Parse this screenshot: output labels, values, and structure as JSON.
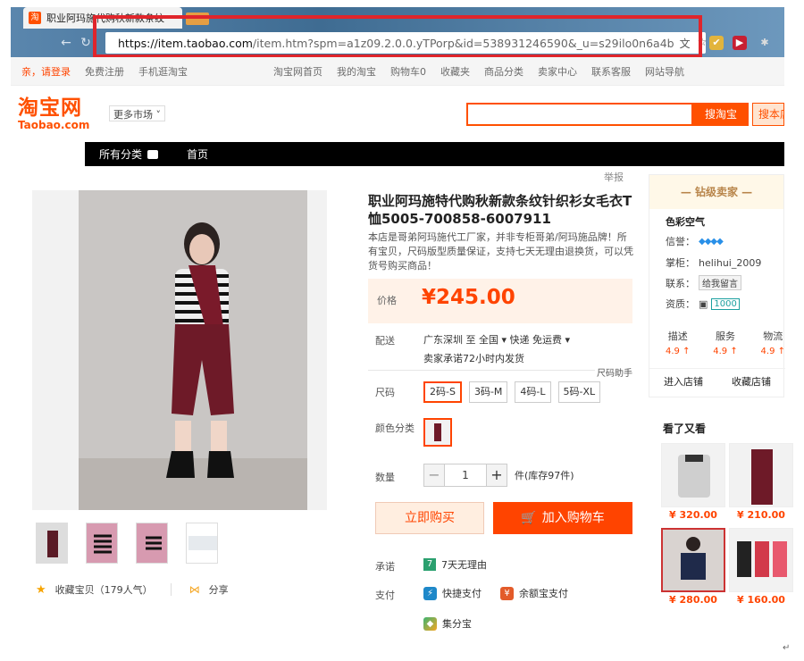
{
  "browser": {
    "tab_title": "职业阿玛施代购秋新款条纹",
    "url_host": "https://item.taobao.com",
    "url_path": "/item.htm?spm=a1z09.2.0.0.yTPorp&id=538931246590&_u=s29ilo0n6a4b"
  },
  "sitebar": {
    "login": "亲，请登录",
    "register": "免费注册",
    "mobile": "手机逛淘宝",
    "home": "淘宝网首页",
    "mytaobao": "我的淘宝",
    "cart": "购物车0",
    "favorites": "收藏夹",
    "categories": "商品分类",
    "seller_center": "卖家中心",
    "service": "联系客服",
    "sitemap": "网站导航"
  },
  "header": {
    "logo_cn": "淘宝网",
    "logo_en": "Taobao.com",
    "more_market": "更多市场",
    "search_button": "搜淘宝",
    "search_button2": "搜本店"
  },
  "nav": {
    "all_categories": "所有分类",
    "home": "首页",
    "report": "举报"
  },
  "product": {
    "title": "职业阿玛施特代购秋新款条纹针织衫女毛衣T恤5005-700858-6007911",
    "subtitle": "本店是哥弟阿玛施代工厂家，并非专柜哥弟/阿玛施品牌！所有宝贝，尺码版型质量保证，支持七天无理由退换货，可以凭货号购买商品！",
    "price_label": "价格",
    "price": "¥245.00",
    "ship_label": "配送",
    "ship_from": "广东深圳 至  全国 ▾   快递 免运费 ▾",
    "ship_promise": "卖家承诺72小时内发货",
    "size_helper": "尺码助手",
    "size_label": "尺码",
    "sizes": [
      "2码-S",
      "3码-M",
      "4码-L",
      "5码-XL"
    ],
    "color_label": "颜色分类",
    "qty_label": "数量",
    "qty_value": "1",
    "stock": "件(库存97件)",
    "buy_now": "立即购买",
    "add_cart": "加入购物车",
    "promise_label": "承诺",
    "promise": "7天无理由",
    "pay_label": "支付",
    "pay_quick": "快捷支付",
    "pay_yuebao": "余额宝支付",
    "pay_jifen": "集分宝",
    "favorite": "收藏宝贝（179人气）",
    "share": "分享"
  },
  "seller": {
    "level": "— 钻级卖家 —",
    "name": "色彩空气",
    "credit_label": "信誉：",
    "credit": "◆◆◆◆",
    "keeper_label": "掌柜：",
    "keeper": "helihui_2009",
    "contact_label": "联系：",
    "contact": "给我留言",
    "qual_label": "资质：",
    "qual": "1000",
    "scores": [
      {
        "label": "描述",
        "value": "4.9 ↑"
      },
      {
        "label": "服务",
        "value": "4.9 ↑"
      },
      {
        "label": "物流",
        "value": "4.9 ↑"
      }
    ],
    "enter_shop": "进入店铺",
    "fav_shop": "收藏店铺"
  },
  "also": {
    "title": "看了又看",
    "items": [
      {
        "price": "¥ 320.00"
      },
      {
        "price": "¥ 210.00"
      },
      {
        "price": "¥ 280.00"
      },
      {
        "price": "¥ 160.00"
      }
    ]
  },
  "colors": {
    "brand": "#ff5000",
    "price": "#ff4400",
    "highlight": "#e0252b"
  }
}
